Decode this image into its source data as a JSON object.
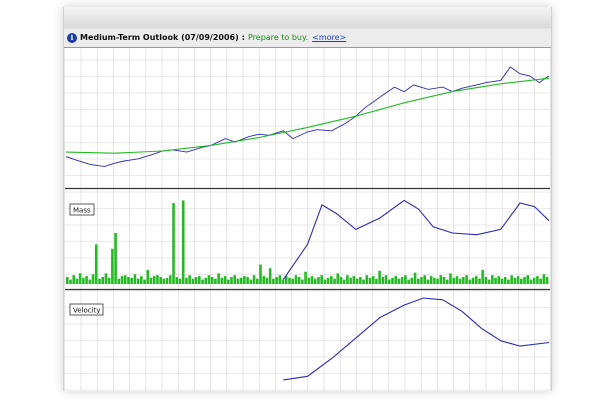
{
  "infobar": {
    "icon": "info-icon",
    "title": "Medium-Term Outlook (07/09/2006)",
    "separator": ":",
    "status": "Prepare to buy.",
    "more_link": "<more>"
  },
  "colors": {
    "price_line": "#2a2ab8",
    "trend_line": "#22bb22",
    "mass_bars": "#22bb22",
    "mass_curve": "#2a2ab8",
    "velocity_curve": "#2a2ab8",
    "grid": "#d6d6d6",
    "panel_border": "#333333"
  },
  "panels": {
    "mass_label": "Mass",
    "velocity_label": "Velocity"
  },
  "chart_data": [
    {
      "type": "line",
      "panel": "price",
      "series": [
        {
          "role": "price",
          "x": [
            0,
            0.02,
            0.05,
            0.08,
            0.1,
            0.12,
            0.15,
            0.18,
            0.2,
            0.22,
            0.25,
            0.28,
            0.3,
            0.33,
            0.35,
            0.38,
            0.4,
            0.42,
            0.45,
            0.47,
            0.5,
            0.52,
            0.55,
            0.58,
            0.6,
            0.62,
            0.64,
            0.66,
            0.68,
            0.7,
            0.72,
            0.75,
            0.78,
            0.8,
            0.82,
            0.85,
            0.87,
            0.9,
            0.92,
            0.94,
            0.96,
            0.98,
            1.0
          ],
          "y": [
            0.12,
            0.09,
            0.05,
            0.03,
            0.06,
            0.08,
            0.1,
            0.14,
            0.17,
            0.18,
            0.16,
            0.2,
            0.22,
            0.28,
            0.25,
            0.3,
            0.32,
            0.31,
            0.35,
            0.28,
            0.34,
            0.36,
            0.35,
            0.42,
            0.48,
            0.56,
            0.62,
            0.68,
            0.74,
            0.7,
            0.76,
            0.72,
            0.74,
            0.7,
            0.73,
            0.76,
            0.78,
            0.8,
            0.92,
            0.86,
            0.84,
            0.78,
            0.84
          ]
        },
        {
          "role": "trend",
          "x": [
            0,
            0.1,
            0.2,
            0.3,
            0.4,
            0.5,
            0.6,
            0.7,
            0.8,
            0.9,
            1.0
          ],
          "y": [
            0.16,
            0.15,
            0.17,
            0.22,
            0.29,
            0.38,
            0.48,
            0.6,
            0.7,
            0.77,
            0.82
          ]
        }
      ]
    },
    {
      "type": "bar",
      "panel": "mass",
      "label": "Mass",
      "series": [
        {
          "role": "bars",
          "values": [
            0.08,
            0.05,
            0.1,
            0.06,
            0.12,
            0.07,
            0.09,
            0.05,
            0.11,
            0.45,
            0.06,
            0.08,
            0.12,
            0.07,
            0.4,
            0.58,
            0.06,
            0.09,
            0.1,
            0.08,
            0.07,
            0.11,
            0.06,
            0.09,
            0.05,
            0.16,
            0.07,
            0.09,
            0.1,
            0.08,
            0.06,
            0.07,
            0.1,
            0.92,
            0.08,
            0.06,
            0.95,
            0.07,
            0.1,
            0.06,
            0.08,
            0.09,
            0.05,
            0.07,
            0.1,
            0.08,
            0.06,
            0.12,
            0.07,
            0.09,
            0.05,
            0.08,
            0.1,
            0.06,
            0.07,
            0.09,
            0.08,
            0.05,
            0.1,
            0.06,
            0.22,
            0.09,
            0.07,
            0.18,
            0.06,
            0.08,
            0.1,
            0.05,
            0.09,
            0.07,
            0.06,
            0.1,
            0.08,
            0.05,
            0.14,
            0.07,
            0.09,
            0.06,
            0.08,
            0.1,
            0.05,
            0.07,
            0.09,
            0.06,
            0.12,
            0.08,
            0.05,
            0.1,
            0.07,
            0.09,
            0.06,
            0.08,
            0.05,
            0.1,
            0.07,
            0.09,
            0.06,
            0.15,
            0.08,
            0.1,
            0.05,
            0.07,
            0.09,
            0.06,
            0.08,
            0.1,
            0.05,
            0.07,
            0.13,
            0.06,
            0.08,
            0.1,
            0.05,
            0.09,
            0.07,
            0.06,
            0.1,
            0.08,
            0.05,
            0.12,
            0.07,
            0.09,
            0.06,
            0.08,
            0.1,
            0.05,
            0.07,
            0.09,
            0.06,
            0.16,
            0.08,
            0.05,
            0.1,
            0.07,
            0.09,
            0.06,
            0.08,
            0.05,
            0.1,
            0.07,
            0.09,
            0.06,
            0.08,
            0.1,
            0.05,
            0.07,
            0.09,
            0.06,
            0.11,
            0.08
          ]
        },
        {
          "role": "curve",
          "x": [
            0.45,
            0.5,
            0.53,
            0.56,
            0.6,
            0.65,
            0.7,
            0.73,
            0.76,
            0.8,
            0.85,
            0.9,
            0.94,
            0.97,
            1.0
          ],
          "y": [
            0.05,
            0.45,
            0.9,
            0.8,
            0.62,
            0.75,
            0.95,
            0.85,
            0.65,
            0.58,
            0.56,
            0.62,
            0.92,
            0.88,
            0.72
          ]
        }
      ]
    },
    {
      "type": "line",
      "panel": "velocity",
      "label": "Velocity",
      "series": [
        {
          "role": "velocity",
          "x": [
            0.45,
            0.5,
            0.55,
            0.6,
            0.65,
            0.7,
            0.74,
            0.78,
            0.82,
            0.86,
            0.9,
            0.94,
            1.0
          ],
          "y": [
            0.08,
            0.12,
            0.32,
            0.55,
            0.78,
            0.92,
            1.0,
            0.98,
            0.85,
            0.66,
            0.52,
            0.46,
            0.5
          ]
        }
      ]
    }
  ]
}
